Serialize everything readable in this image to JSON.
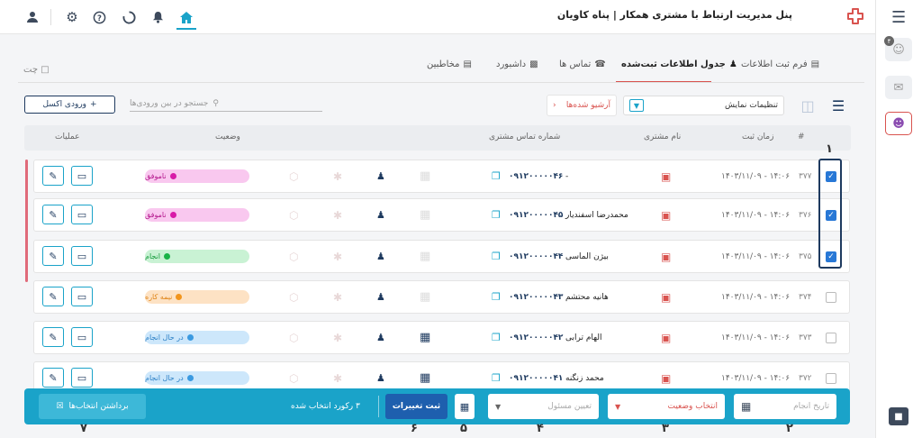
{
  "header": {
    "title": "پنل مدیریت ارتباط با مشتری همکار | پناه کاویان"
  },
  "topbar_icons": [
    "user-icon",
    "gear-icon",
    "help-icon",
    "loading-icon",
    "bell-icon",
    "home-icon"
  ],
  "tabs": [
    {
      "label": "فرم ثبت اطلاعات"
    },
    {
      "label": "جدول اطلاعات ثبت‌شده"
    },
    {
      "label": "تماس ها"
    },
    {
      "label": "داشبورد"
    },
    {
      "label": "مخاطبین"
    }
  ],
  "chat_label": "چت",
  "toolbar": {
    "excel_label": "ورودی اکسل",
    "search_placeholder": "جستجو در بین ورودی‌ها",
    "archive_label": "آرشیو شده‌ها",
    "view_settings_label": "تنظیمات نمایش"
  },
  "table": {
    "headers": {
      "num": "#",
      "time": "زمان ثبت",
      "name": "نام مشتری",
      "phone": "شماره تماس مشتری",
      "status": "وضعیت",
      "ops": "عملیات"
    },
    "rows": [
      {
        "id": "۳۷۷",
        "time": "۱۴۰۳/۱۱/۰۹ - ۱۴:۰۶",
        "name": "-",
        "phone": "۰۹۱۲۰۰۰۰۰۴۶",
        "status": "ناموفق",
        "checked": true
      },
      {
        "id": "۳۷۶",
        "time": "۱۴۰۳/۱۱/۰۹ - ۱۴:۰۶",
        "name": "محمدرضا اسفندیار",
        "phone": "۰۹۱۲۰۰۰۰۰۴۵",
        "status": "ناموفق",
        "checked": true
      },
      {
        "id": "۳۷۵",
        "time": "۱۴۰۳/۱۱/۰۹ - ۱۴:۰۶",
        "name": "بیژن الماسی",
        "phone": "۰۹۱۲۰۰۰۰۰۴۴",
        "status": "انجام",
        "checked": true
      },
      {
        "id": "۳۷۴",
        "time": "۱۴۰۳/۱۱/۰۹ - ۱۴:۰۶",
        "name": "هانیه محتشم",
        "phone": "۰۹۱۲۰۰۰۰۰۴۳",
        "status": "نیمه کاره",
        "checked": false
      },
      {
        "id": "۳۷۳",
        "time": "۱۴۰۳/۱۱/۰۹ - ۱۴:۰۶",
        "name": "الهام ترابی",
        "phone": "۰۹۱۲۰۰۰۰۰۴۲",
        "status": "در حال انجام",
        "checked": false
      },
      {
        "id": "۳۷۲",
        "time": "۱۴۰۳/۱۱/۰۹ - ۱۴:۰۶",
        "name": "محمد زنگنه",
        "phone": "۰۹۱۲۰۰۰۰۰۴۱",
        "status": "در حال انجام",
        "checked": false
      }
    ]
  },
  "status_colors": {
    "ناموفق": {
      "bg": "#f9c8ef",
      "dot": "#d81ba8",
      "text": "#b3158b"
    },
    "انجام": {
      "bg": "#c9f2d4",
      "dot": "#19b347",
      "text": "#139a3a"
    },
    "نیمه کاره": {
      "bg": "#fde2c4",
      "dot": "#f2951d",
      "text": "#e0861a"
    },
    "در حال انجام": {
      "bg": "#cde7fb",
      "dot": "#3b9ae1",
      "text": "#2a7fc5"
    }
  },
  "bottom_bar": {
    "date_placeholder": "تاریخ انجام",
    "status_select": "انتخاب وضعیت",
    "owner_placeholder": "تعیین مسئول",
    "save_label": "ثبت تغییرات",
    "selected_count": "۳ رکورد انتخاب شده",
    "clear_label": "برداشتن انتخاب‌ها"
  },
  "annotations": {
    "a1": "۱",
    "a2": "۲",
    "a3": "۳",
    "a4": "۴",
    "a5": "۵",
    "a6": "۶",
    "a7": "۷"
  },
  "rail_badge": "۴",
  "accent_color": "#1aa3c9",
  "brand_color": "#d9534f"
}
